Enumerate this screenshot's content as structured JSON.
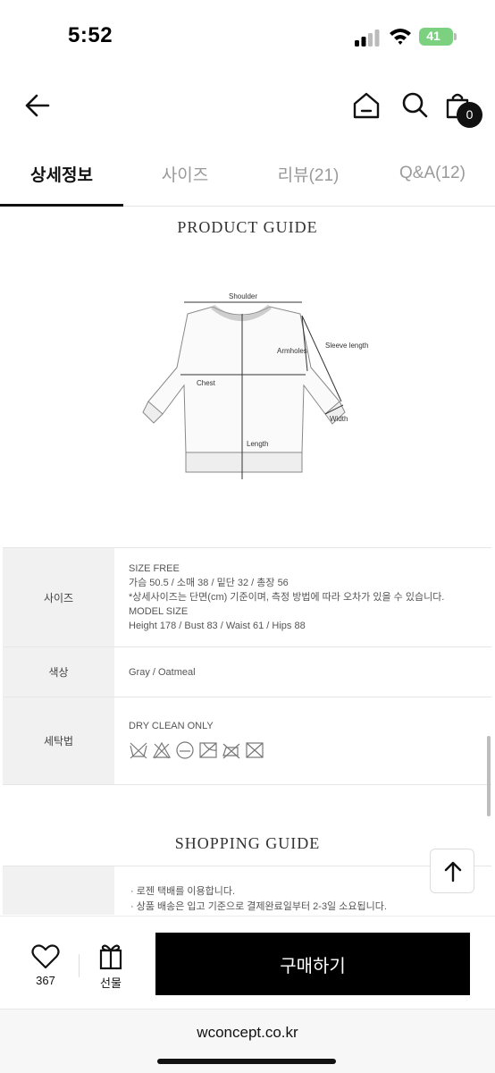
{
  "status_bar": {
    "time": "5:52",
    "battery": "41",
    "battery_color": "#7bd17f"
  },
  "header": {
    "back_icon": "arrow-left-icon",
    "home_icon": "home-icon",
    "search_icon": "search-icon",
    "bag_icon": "shopping-bag-icon",
    "cart_count": "0"
  },
  "tabs": [
    {
      "label": "상세정보",
      "active": true
    },
    {
      "label": "사이즈",
      "active": false
    },
    {
      "label": "리뷰(21)",
      "active": false
    },
    {
      "label": "Q&A(12)",
      "active": false
    }
  ],
  "product_guide": {
    "title": "PRODUCT GUIDE",
    "diagram_labels": {
      "shoulder": "Shoulder",
      "armholes": "Armholes",
      "sleeve_length": "Sleeve length",
      "chest": "Chest",
      "width": "Width",
      "length": "Length"
    }
  },
  "info_table": {
    "size": {
      "label": "사이즈",
      "lines": [
        "SIZE  FREE",
        "가슴 50.5 / 소매 38 / 밑단 32 / 총장 56",
        "*상세사이즈는 단면(cm) 기준이며, 측정 방법에 따라 오차가 있을 수 있습니다.",
        "MODEL SIZE",
        "Height 178 / Bust  83 / Waist 61 / Hips 88"
      ]
    },
    "color": {
      "label": "색상",
      "value": "Gray / Oatmeal"
    },
    "wash": {
      "label": "세탁법",
      "value": "DRY CLEAN ONLY",
      "icons": [
        "no-wash-icon",
        "no-bleach-icon",
        "dry-clean-icon",
        "no-tumble-dry-icon",
        "no-iron-icon",
        "no-wring-icon"
      ]
    }
  },
  "shopping_guide": {
    "title": "SHOPPING GUIDE",
    "lines": [
      "· 로젠 택배를 이용합니다.",
      "· 상품 배송은 입고 기준으로 결제완료일부터 2-3일 소요됩니다."
    ]
  },
  "action_bar": {
    "like_count": "367",
    "gift_label": "선물",
    "buy_label": "구매하기"
  },
  "browser": {
    "url": "wconcept.co.kr"
  }
}
